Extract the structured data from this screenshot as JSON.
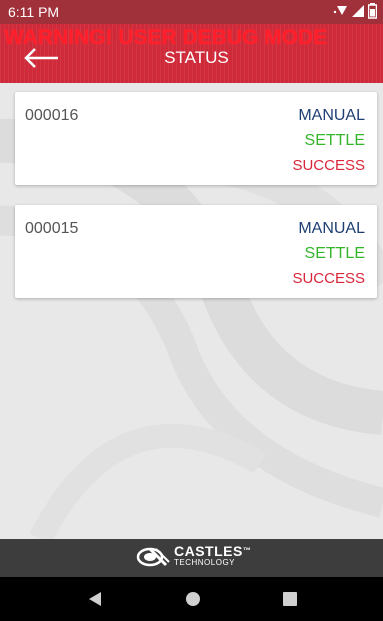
{
  "status_bar": {
    "time": "6:11 PM"
  },
  "app_bar": {
    "warning": "WARNING! USER DEBUG MODE",
    "title": "STATUS"
  },
  "transactions": [
    {
      "id": "000016",
      "type": "MANUAL",
      "operation": "SETTLE",
      "result": "SUCCESS"
    },
    {
      "id": "000015",
      "type": "MANUAL",
      "operation": "SETTLE",
      "result": "SUCCESS"
    }
  ],
  "footer": {
    "brand": "CASTLES",
    "trademark": "™",
    "tagline": "TECHNOLOGY"
  },
  "colors": {
    "app_bar": "#cf2a39",
    "type": "#1e3f73",
    "operation": "#35b52b",
    "result": "#d9263a"
  },
  "icons": {
    "status": [
      "wifi-icon",
      "signal-icon",
      "battery-icon"
    ],
    "back": "back-arrow-icon",
    "nav": [
      "nav-back-icon",
      "nav-home-icon",
      "nav-recents-icon"
    ]
  }
}
